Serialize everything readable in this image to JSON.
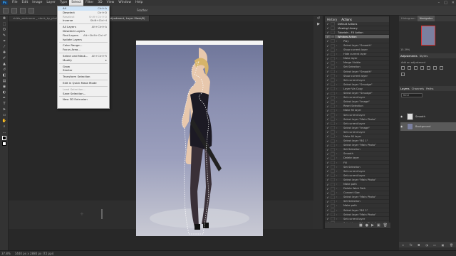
{
  "menubar": {
    "logo": "Ps",
    "items": [
      "File",
      "Edit",
      "Image",
      "Layer",
      "Type",
      "Select",
      "Filter",
      "3D",
      "View",
      "Window",
      "Help"
    ]
  },
  "options": {
    "label": "Feather"
  },
  "tabs": [
    {
      "label": "vidéo_workroom _ stock_by_photomaniac..."
    },
    {
      "label": "ass 1.psd @ 15.5% (Adjustment, Layer Mask/8)"
    }
  ],
  "select_menu": [
    {
      "label": "All",
      "shortcut": "Ctrl+A",
      "disabled": false
    },
    {
      "label": "Deselect",
      "shortcut": "Ctrl+D",
      "disabled": false
    },
    {
      "label": "Reselect",
      "shortcut": "Shift+Ctrl+D",
      "disabled": true
    },
    {
      "label": "Inverse",
      "shortcut": "Shift+Ctrl+I",
      "disabled": false
    },
    {
      "sep": true
    },
    {
      "label": "All Layers",
      "shortcut": "Alt+Ctrl+A",
      "disabled": false
    },
    {
      "label": "Deselect Layers",
      "shortcut": "",
      "disabled": false
    },
    {
      "label": "Find Layers",
      "shortcut": "Alt+Shift+Ctrl+F",
      "disabled": false
    },
    {
      "label": "Isolate Layers",
      "shortcut": "",
      "disabled": false
    },
    {
      "sep": true
    },
    {
      "label": "Color Range...",
      "shortcut": "",
      "disabled": false
    },
    {
      "label": "Focus Area...",
      "shortcut": "",
      "disabled": false
    },
    {
      "sep": true
    },
    {
      "label": "Select and Mask...",
      "shortcut": "Alt+Ctrl+R",
      "disabled": false
    },
    {
      "label": "Modify",
      "shortcut": "▸",
      "disabled": false
    },
    {
      "sep": true
    },
    {
      "label": "Grow",
      "shortcut": "",
      "disabled": false
    },
    {
      "label": "Similar",
      "shortcut": "",
      "disabled": false
    },
    {
      "sep": true
    },
    {
      "label": "Transform Selection",
      "shortcut": "",
      "disabled": false
    },
    {
      "sep": true
    },
    {
      "label": "Edit in Quick Mask Mode",
      "shortcut": "",
      "disabled": false
    },
    {
      "sep": true
    },
    {
      "label": "Load Selection...",
      "shortcut": "",
      "disabled": true
    },
    {
      "label": "Save Selection...",
      "shortcut": "",
      "disabled": false
    },
    {
      "sep": true
    },
    {
      "label": "New 3D Extrusion",
      "shortcut": "",
      "disabled": false
    }
  ],
  "actions_panel": {
    "tabs": [
      "History",
      "Actions"
    ],
    "rows": [
      {
        "label": "Default Actions",
        "folder": true
      },
      {
        "label": "Viewing Library",
        "folder": true
      },
      {
        "label": "Tutorials - FX Action",
        "folder": true
      },
      {
        "label": "Window Action",
        "folder": true,
        "selected": true
      },
      {
        "label": "Play"
      },
      {
        "label": "Select layer \"Smooth\""
      },
      {
        "label": "Show current layer"
      },
      {
        "label": "Hide current layer"
      },
      {
        "label": "Make layer"
      },
      {
        "label": "Merge Visible"
      },
      {
        "label": "Set Selection"
      },
      {
        "label": "Select layer \"Smooth\""
      },
      {
        "label": "Show current layer"
      },
      {
        "label": "Set current layer"
      },
      {
        "label": "Select layer \"Smudge\""
      },
      {
        "label": "Layer Via Copy"
      },
      {
        "label": "Select layer \"Smudge\""
      },
      {
        "label": "Set current layer"
      },
      {
        "label": "Select layer \"Image\""
      },
      {
        "label": "Reset Selection"
      },
      {
        "label": "Make fill layer"
      },
      {
        "label": "Set current layer"
      },
      {
        "label": "Select layer \"Main Photo\""
      },
      {
        "label": "Set current layer"
      },
      {
        "label": "Select layer \"Image\""
      },
      {
        "label": "Set current layer"
      },
      {
        "label": "Make fill layer"
      },
      {
        "label": "Select layer \"BG 1\""
      },
      {
        "label": "Select layer \"Main Photo\""
      },
      {
        "label": "Set Selection"
      },
      {
        "label": "Smooth"
      },
      {
        "label": "Delete layer"
      },
      {
        "label": "Fill"
      },
      {
        "label": "Set Selection"
      },
      {
        "label": "Set current layer"
      },
      {
        "label": "Set current layer"
      },
      {
        "label": "Select layer \"Main Photo\""
      },
      {
        "label": "Make path"
      },
      {
        "label": "Delete Work Path"
      },
      {
        "label": "Convert Size"
      },
      {
        "label": "Select layer \"Main Photo\""
      },
      {
        "label": "Set Selection"
      },
      {
        "label": "Make path"
      },
      {
        "label": "Select layer \"BG 2\""
      },
      {
        "label": "Select layer \"Main Photo\""
      },
      {
        "label": "Set current layer"
      },
      {
        "label": "Select layer \"Main Photo\""
      }
    ]
  },
  "right_panels": {
    "top_tabs": [
      "Histogram",
      "Navigator"
    ],
    "zoom": "15.39%",
    "adj_tabs": [
      "Adjustments",
      "Styles"
    ],
    "adj_hint": "Add an adjustment",
    "layer_tabs": [
      "Layers",
      "Channels",
      "Paths"
    ],
    "kind": "Kind",
    "layers": [
      {
        "label": "Smooth",
        "selected": false
      },
      {
        "label": "Background",
        "selected": true
      }
    ]
  },
  "status": {
    "zoom": "37.8%",
    "doc": "1440 px x 2880 px (72 ppi)"
  }
}
